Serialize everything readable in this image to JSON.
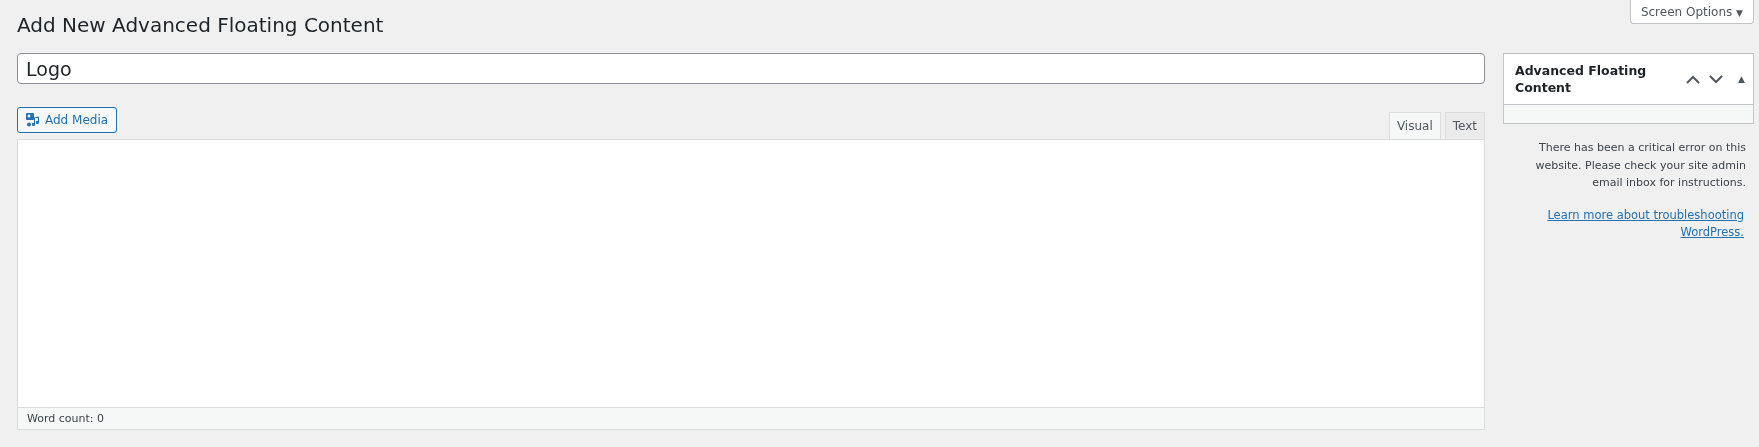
{
  "screen_options": {
    "label": "Screen Options",
    "arrow": "▼"
  },
  "title": "Add New Advanced Floating Content",
  "post_title": {
    "value": "Logo"
  },
  "add_media": {
    "label": "Add Media"
  },
  "editor_tabs": [
    {
      "label": "Visual",
      "selected": true
    },
    {
      "label": "Text",
      "selected": false
    }
  ],
  "word_count": "Word count: 0",
  "sidebar_box": {
    "title": "Advanced Floating Content",
    "toggle": "▲"
  },
  "error": {
    "message": "There has been a critical error on this website. Please check your site admin email inbox for instructions.",
    "link": "Learn more about troubleshooting WordPress."
  }
}
